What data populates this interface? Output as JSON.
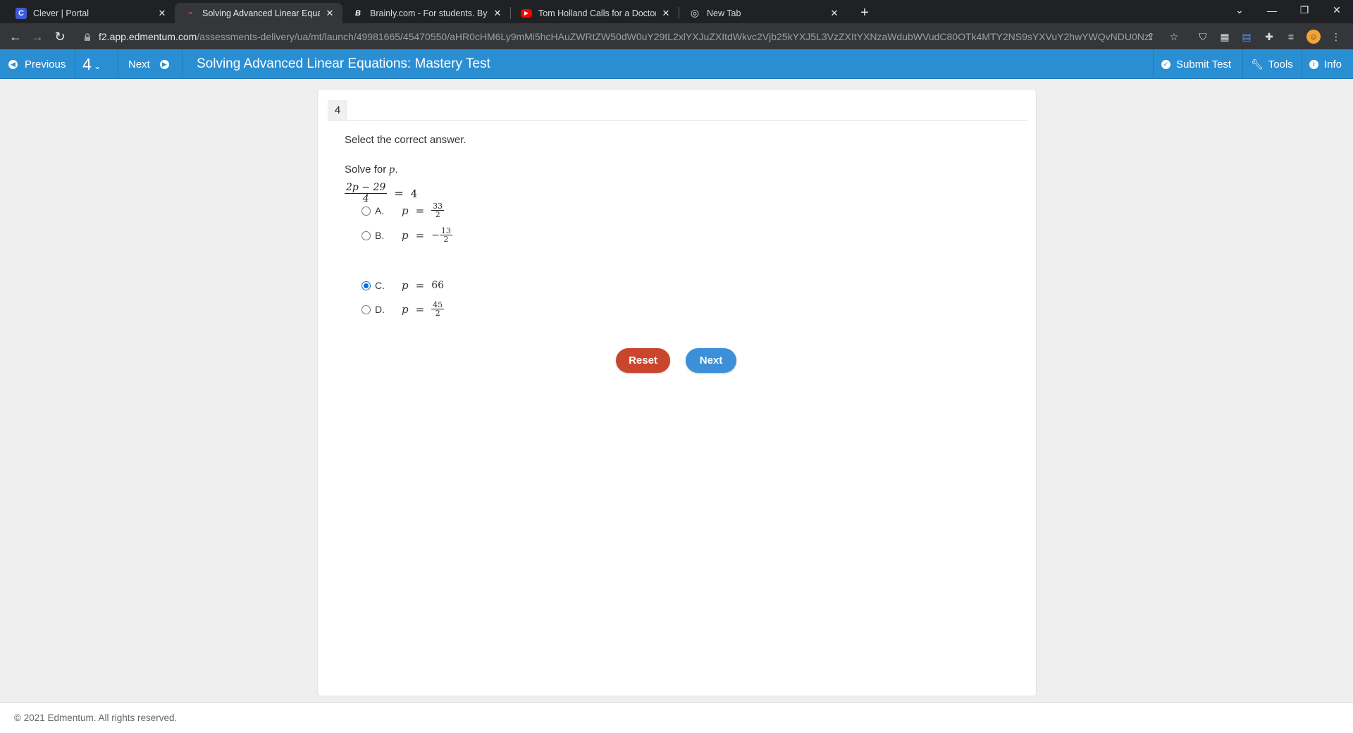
{
  "browser": {
    "tabs": [
      {
        "title": "Clever | Portal",
        "favicon_color": "#3d5bd9",
        "favicon_glyph": "C"
      },
      {
        "title": "Solving Advanced Linear Equatio",
        "favicon_color": "#35363a",
        "favicon_glyph": "••"
      },
      {
        "title": "Brainly.com - For students. By stu",
        "favicon_color": "#202124",
        "favicon_glyph": "B"
      },
      {
        "title": "Tom Holland Calls for a Doctor W",
        "favicon_color": "#ff0000",
        "favicon_glyph": "▶"
      },
      {
        "title": "New Tab",
        "favicon_color": "#202124",
        "favicon_glyph": "◎"
      }
    ],
    "url_host": "f2.app.edmentum.com",
    "url_path": "/assessments-delivery/ua/mt/launch/49981665/45470550/aHR0cHM6Ly9mMi5hcHAuZWRtZW50dW0uY29tL2xlYXJuZXItdWkvc2Vjb25kYXJ5L3VzZXItYXNzaWdubWVudC80OTk4MTY2NS9sYXVuY2hwYWQvNDU0NzA..."
  },
  "app": {
    "previous_label": "Previous",
    "question_number": "4",
    "next_label": "Next",
    "title": "Solving Advanced Linear Equations: Mastery Test",
    "submit_label": "Submit Test",
    "tools_label": "Tools",
    "info_label": "Info",
    "brand_color": "#2a8ed3"
  },
  "question": {
    "number": "4",
    "instruction": "Select the correct answer.",
    "prompt_prefix": "Solve for",
    "prompt_var": "p",
    "prompt_suffix": ".",
    "equation": {
      "numerator": "2p − 29",
      "denominator": "4",
      "eq": "=",
      "rhs": "4"
    },
    "options": [
      {
        "letter": "A.",
        "var": "p",
        "eq": "=",
        "sign": "",
        "numerator": "33",
        "denominator": "2",
        "value": "",
        "selected": false
      },
      {
        "letter": "B.",
        "var": "p",
        "eq": "=",
        "sign": "−",
        "numerator": "13",
        "denominator": "2",
        "value": "",
        "selected": false
      },
      {
        "letter": "C.",
        "var": "p",
        "eq": "=",
        "sign": "",
        "numerator": "",
        "denominator": "",
        "value": "66",
        "selected": true
      },
      {
        "letter": "D.",
        "var": "p",
        "eq": "=",
        "sign": "",
        "numerator": "45",
        "denominator": "2",
        "value": "",
        "selected": false
      }
    ],
    "reset_label": "Reset",
    "next_label": "Next"
  },
  "footer": {
    "copyright": "© 2021 Edmentum. All rights reserved."
  }
}
